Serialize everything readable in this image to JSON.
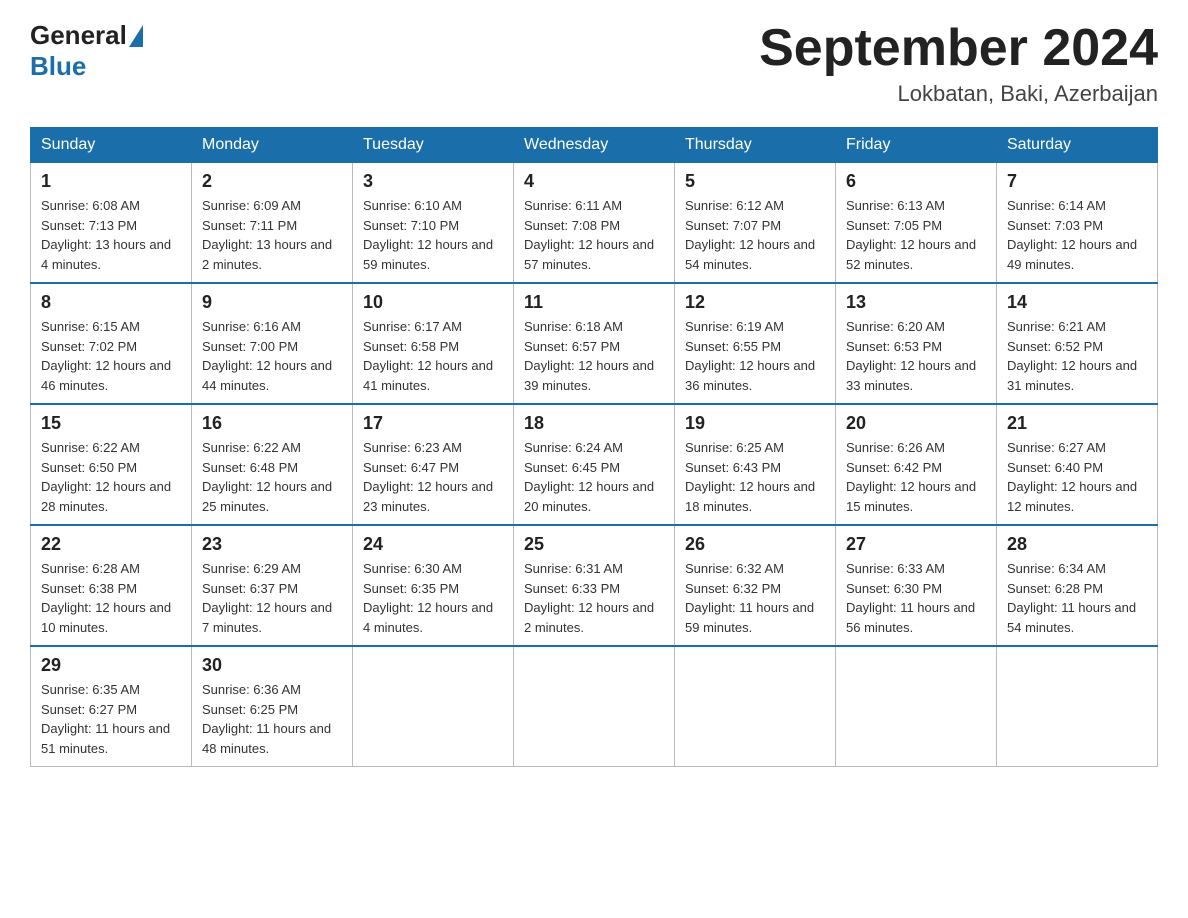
{
  "header": {
    "logo_general": "General",
    "logo_blue": "Blue",
    "month_title": "September 2024",
    "location": "Lokbatan, Baki, Azerbaijan"
  },
  "columns": [
    "Sunday",
    "Monday",
    "Tuesday",
    "Wednesday",
    "Thursday",
    "Friday",
    "Saturday"
  ],
  "weeks": [
    [
      {
        "day": "1",
        "sunrise": "Sunrise: 6:08 AM",
        "sunset": "Sunset: 7:13 PM",
        "daylight": "Daylight: 13 hours and 4 minutes."
      },
      {
        "day": "2",
        "sunrise": "Sunrise: 6:09 AM",
        "sunset": "Sunset: 7:11 PM",
        "daylight": "Daylight: 13 hours and 2 minutes."
      },
      {
        "day": "3",
        "sunrise": "Sunrise: 6:10 AM",
        "sunset": "Sunset: 7:10 PM",
        "daylight": "Daylight: 12 hours and 59 minutes."
      },
      {
        "day": "4",
        "sunrise": "Sunrise: 6:11 AM",
        "sunset": "Sunset: 7:08 PM",
        "daylight": "Daylight: 12 hours and 57 minutes."
      },
      {
        "day": "5",
        "sunrise": "Sunrise: 6:12 AM",
        "sunset": "Sunset: 7:07 PM",
        "daylight": "Daylight: 12 hours and 54 minutes."
      },
      {
        "day": "6",
        "sunrise": "Sunrise: 6:13 AM",
        "sunset": "Sunset: 7:05 PM",
        "daylight": "Daylight: 12 hours and 52 minutes."
      },
      {
        "day": "7",
        "sunrise": "Sunrise: 6:14 AM",
        "sunset": "Sunset: 7:03 PM",
        "daylight": "Daylight: 12 hours and 49 minutes."
      }
    ],
    [
      {
        "day": "8",
        "sunrise": "Sunrise: 6:15 AM",
        "sunset": "Sunset: 7:02 PM",
        "daylight": "Daylight: 12 hours and 46 minutes."
      },
      {
        "day": "9",
        "sunrise": "Sunrise: 6:16 AM",
        "sunset": "Sunset: 7:00 PM",
        "daylight": "Daylight: 12 hours and 44 minutes."
      },
      {
        "day": "10",
        "sunrise": "Sunrise: 6:17 AM",
        "sunset": "Sunset: 6:58 PM",
        "daylight": "Daylight: 12 hours and 41 minutes."
      },
      {
        "day": "11",
        "sunrise": "Sunrise: 6:18 AM",
        "sunset": "Sunset: 6:57 PM",
        "daylight": "Daylight: 12 hours and 39 minutes."
      },
      {
        "day": "12",
        "sunrise": "Sunrise: 6:19 AM",
        "sunset": "Sunset: 6:55 PM",
        "daylight": "Daylight: 12 hours and 36 minutes."
      },
      {
        "day": "13",
        "sunrise": "Sunrise: 6:20 AM",
        "sunset": "Sunset: 6:53 PM",
        "daylight": "Daylight: 12 hours and 33 minutes."
      },
      {
        "day": "14",
        "sunrise": "Sunrise: 6:21 AM",
        "sunset": "Sunset: 6:52 PM",
        "daylight": "Daylight: 12 hours and 31 minutes."
      }
    ],
    [
      {
        "day": "15",
        "sunrise": "Sunrise: 6:22 AM",
        "sunset": "Sunset: 6:50 PM",
        "daylight": "Daylight: 12 hours and 28 minutes."
      },
      {
        "day": "16",
        "sunrise": "Sunrise: 6:22 AM",
        "sunset": "Sunset: 6:48 PM",
        "daylight": "Daylight: 12 hours and 25 minutes."
      },
      {
        "day": "17",
        "sunrise": "Sunrise: 6:23 AM",
        "sunset": "Sunset: 6:47 PM",
        "daylight": "Daylight: 12 hours and 23 minutes."
      },
      {
        "day": "18",
        "sunrise": "Sunrise: 6:24 AM",
        "sunset": "Sunset: 6:45 PM",
        "daylight": "Daylight: 12 hours and 20 minutes."
      },
      {
        "day": "19",
        "sunrise": "Sunrise: 6:25 AM",
        "sunset": "Sunset: 6:43 PM",
        "daylight": "Daylight: 12 hours and 18 minutes."
      },
      {
        "day": "20",
        "sunrise": "Sunrise: 6:26 AM",
        "sunset": "Sunset: 6:42 PM",
        "daylight": "Daylight: 12 hours and 15 minutes."
      },
      {
        "day": "21",
        "sunrise": "Sunrise: 6:27 AM",
        "sunset": "Sunset: 6:40 PM",
        "daylight": "Daylight: 12 hours and 12 minutes."
      }
    ],
    [
      {
        "day": "22",
        "sunrise": "Sunrise: 6:28 AM",
        "sunset": "Sunset: 6:38 PM",
        "daylight": "Daylight: 12 hours and 10 minutes."
      },
      {
        "day": "23",
        "sunrise": "Sunrise: 6:29 AM",
        "sunset": "Sunset: 6:37 PM",
        "daylight": "Daylight: 12 hours and 7 minutes."
      },
      {
        "day": "24",
        "sunrise": "Sunrise: 6:30 AM",
        "sunset": "Sunset: 6:35 PM",
        "daylight": "Daylight: 12 hours and 4 minutes."
      },
      {
        "day": "25",
        "sunrise": "Sunrise: 6:31 AM",
        "sunset": "Sunset: 6:33 PM",
        "daylight": "Daylight: 12 hours and 2 minutes."
      },
      {
        "day": "26",
        "sunrise": "Sunrise: 6:32 AM",
        "sunset": "Sunset: 6:32 PM",
        "daylight": "Daylight: 11 hours and 59 minutes."
      },
      {
        "day": "27",
        "sunrise": "Sunrise: 6:33 AM",
        "sunset": "Sunset: 6:30 PM",
        "daylight": "Daylight: 11 hours and 56 minutes."
      },
      {
        "day": "28",
        "sunrise": "Sunrise: 6:34 AM",
        "sunset": "Sunset: 6:28 PM",
        "daylight": "Daylight: 11 hours and 54 minutes."
      }
    ],
    [
      {
        "day": "29",
        "sunrise": "Sunrise: 6:35 AM",
        "sunset": "Sunset: 6:27 PM",
        "daylight": "Daylight: 11 hours and 51 minutes."
      },
      {
        "day": "30",
        "sunrise": "Sunrise: 6:36 AM",
        "sunset": "Sunset: 6:25 PM",
        "daylight": "Daylight: 11 hours and 48 minutes."
      },
      {
        "day": "",
        "sunrise": "",
        "sunset": "",
        "daylight": ""
      },
      {
        "day": "",
        "sunrise": "",
        "sunset": "",
        "daylight": ""
      },
      {
        "day": "",
        "sunrise": "",
        "sunset": "",
        "daylight": ""
      },
      {
        "day": "",
        "sunrise": "",
        "sunset": "",
        "daylight": ""
      },
      {
        "day": "",
        "sunrise": "",
        "sunset": "",
        "daylight": ""
      }
    ]
  ]
}
